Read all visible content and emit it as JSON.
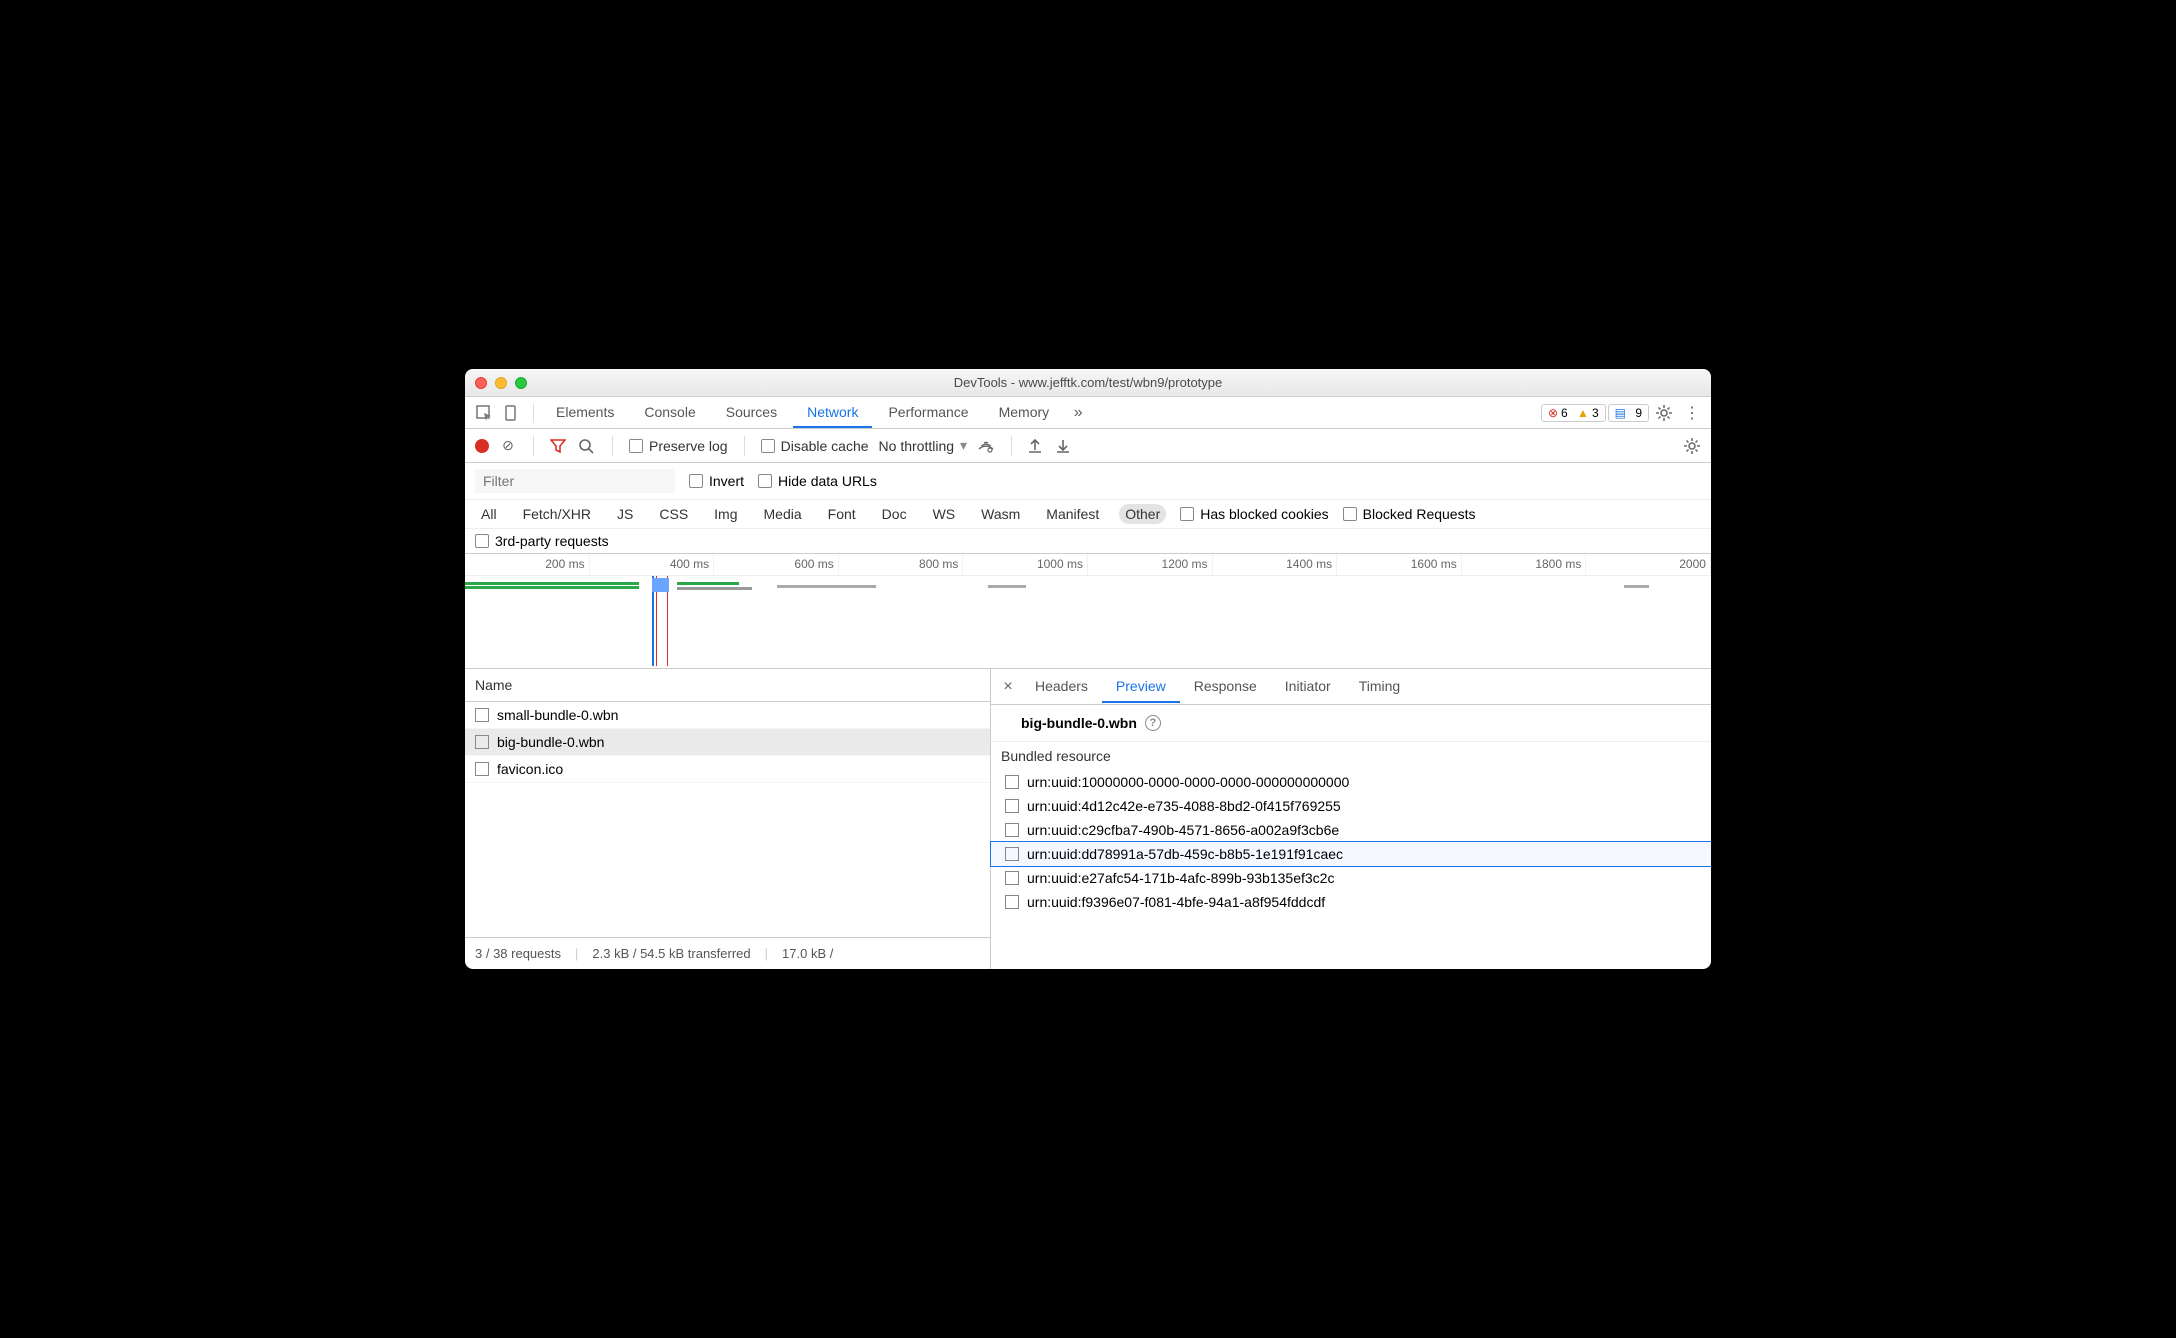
{
  "title": "DevTools - www.jefftk.com/test/wbn9/prototype",
  "tabs": [
    "Elements",
    "Console",
    "Sources",
    "Network",
    "Performance",
    "Memory"
  ],
  "active_tab": "Network",
  "badges": {
    "errors": 6,
    "warnings": 3,
    "msgs": 9
  },
  "toolbar": {
    "preserve": "Preserve log",
    "disable_cache": "Disable cache",
    "throttling": "No throttling"
  },
  "filter": {
    "placeholder": "Filter",
    "invert": "Invert",
    "hide_data": "Hide data URLs"
  },
  "types": [
    "All",
    "Fetch/XHR",
    "JS",
    "CSS",
    "Img",
    "Media",
    "Font",
    "Doc",
    "WS",
    "Wasm",
    "Manifest",
    "Other"
  ],
  "type_selected": "Other",
  "type_opts": {
    "blocked_cookies": "Has blocked cookies",
    "blocked_req": "Blocked Requests"
  },
  "third_party": "3rd-party requests",
  "timeline_ticks": [
    "200 ms",
    "400 ms",
    "600 ms",
    "800 ms",
    "1000 ms",
    "1200 ms",
    "1400 ms",
    "1600 ms",
    "1800 ms",
    "2000"
  ],
  "name_header": "Name",
  "requests": [
    {
      "name": "small-bundle-0.wbn",
      "sel": false
    },
    {
      "name": "big-bundle-0.wbn",
      "sel": true
    },
    {
      "name": "favicon.ico",
      "sel": false
    }
  ],
  "status": {
    "a": "3 / 38 requests",
    "b": "2.3 kB / 54.5 kB transferred",
    "c": "17.0 kB /"
  },
  "detail_tabs": [
    "Headers",
    "Preview",
    "Response",
    "Initiator",
    "Timing"
  ],
  "detail_active": "Preview",
  "preview": {
    "title": "big-bundle-0.wbn",
    "section": "Bundled resource",
    "items": [
      "urn:uuid:10000000-0000-0000-0000-000000000000",
      "urn:uuid:4d12c42e-e735-4088-8bd2-0f415f769255",
      "urn:uuid:c29cfba7-490b-4571-8656-a002a9f3cb6e",
      "urn:uuid:dd78991a-57db-459c-b8b5-1e191f91caec",
      "urn:uuid:e27afc54-171b-4afc-899b-93b135ef3c2c",
      "urn:uuid:f9396e07-f081-4bfe-94a1-a8f954fddcdf"
    ],
    "highlight_index": 3
  }
}
